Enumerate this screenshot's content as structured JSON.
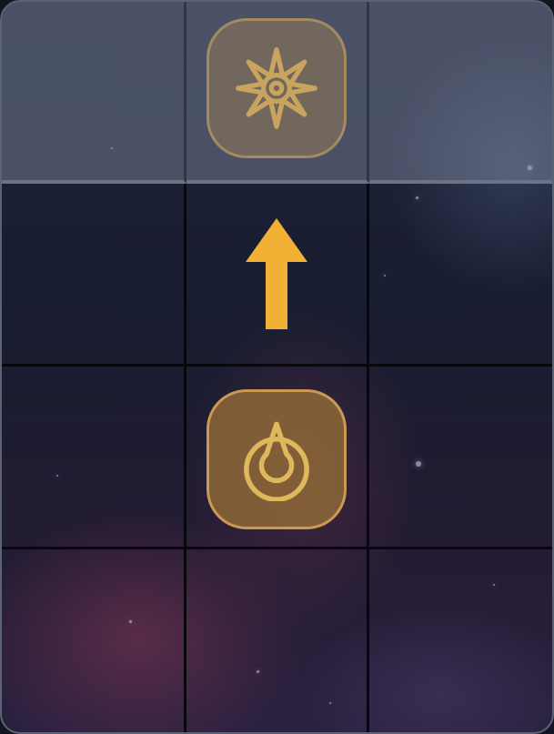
{
  "board": {
    "rows": 4,
    "cols": 3,
    "highlighted_row": 0
  },
  "colors": {
    "accent": "#f2b035",
    "tile_gold": "#c9a45e",
    "grid_line": "#07080d",
    "frame": "#5a6474"
  },
  "pieces": {
    "goal": {
      "row": 0,
      "col": 1,
      "icon": "sun-emblem-icon"
    },
    "player": {
      "row": 2,
      "col": 1,
      "icon": "flame-emblem-icon"
    },
    "move_arrow": {
      "row": 1,
      "col": 1,
      "direction": "up",
      "icon": "arrow-up-icon"
    }
  }
}
